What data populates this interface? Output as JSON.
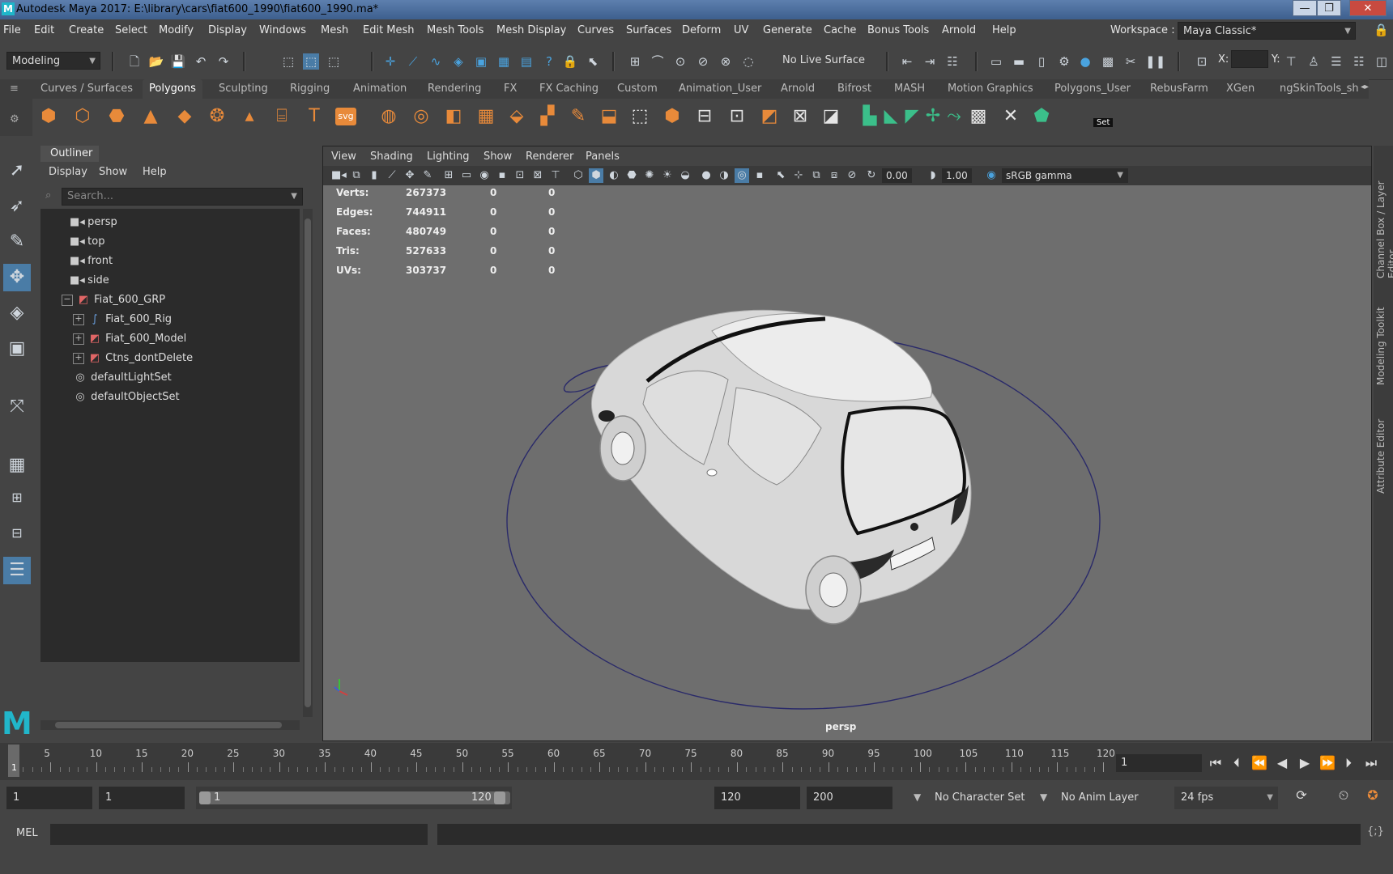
{
  "window": {
    "title": "Autodesk Maya 2017: E:\\library\\cars\\fiat600_1990\\fiat600_1990.ma*",
    "logo": "M"
  },
  "menubar": {
    "items": [
      "File",
      "Edit",
      "Create",
      "Select",
      "Modify",
      "Display",
      "Windows",
      "Mesh",
      "Edit Mesh",
      "Mesh Tools",
      "Mesh Display",
      "Curves",
      "Surfaces",
      "Deform",
      "UV",
      "Generate",
      "Cache",
      "Bonus Tools",
      "Arnold",
      "Help"
    ],
    "workspace_label": "Workspace :",
    "workspace_value": "Maya Classic*"
  },
  "toolbar": {
    "mode": "Modeling",
    "live_surface": "No Live Surface",
    "x_label": "X:",
    "y_label": "Y:"
  },
  "shelf": {
    "tabs": [
      "Curves / Surfaces",
      "Polygons",
      "Sculpting",
      "Rigging",
      "Animation",
      "Rendering",
      "FX",
      "FX Caching",
      "Custom",
      "Animation_User",
      "Arnold",
      "Bifrost",
      "MASH",
      "Motion Graphics",
      "Polygons_User",
      "RebusFarm",
      "XGen",
      "ngSkinTools_she"
    ],
    "active_tab": "Polygons",
    "svg_label": "svg",
    "text_label": "T",
    "set_label": "Set"
  },
  "outliner": {
    "title": "Outliner",
    "menu": [
      "Display",
      "Show",
      "Help"
    ],
    "search_placeholder": "Search...",
    "nodes": [
      {
        "label": "persp",
        "icon": "camera-icon",
        "expand": ""
      },
      {
        "label": "top",
        "icon": "camera-icon",
        "expand": ""
      },
      {
        "label": "front",
        "icon": "camera-icon",
        "expand": ""
      },
      {
        "label": "side",
        "icon": "camera-icon",
        "expand": ""
      },
      {
        "label": "Fiat_600_GRP",
        "icon": "group-icon",
        "expand": "−"
      },
      {
        "label": "Fiat_600_Rig",
        "icon": "curve-icon",
        "expand": "+"
      },
      {
        "label": "Fiat_600_Model",
        "icon": "group-icon",
        "expand": "+"
      },
      {
        "label": "Ctns_dontDelete",
        "icon": "group-icon",
        "expand": "+"
      },
      {
        "label": "defaultLightSet",
        "icon": "set-icon",
        "expand": ""
      },
      {
        "label": "defaultObjectSet",
        "icon": "set-icon",
        "expand": ""
      }
    ]
  },
  "panel": {
    "menu": [
      "View",
      "Shading",
      "Lighting",
      "Show",
      "Renderer",
      "Panels"
    ],
    "exposure": "0.00",
    "gamma": "1.00",
    "color_space": "sRGB gamma",
    "camera": "persp"
  },
  "hud": [
    {
      "label": "Verts:",
      "total": "267373",
      "sel": "0",
      "comp": "0"
    },
    {
      "label": "Edges:",
      "total": "744911",
      "sel": "0",
      "comp": "0"
    },
    {
      "label": "Faces:",
      "total": "480749",
      "sel": "0",
      "comp": "0"
    },
    {
      "label": "Tris:",
      "total": "527633",
      "sel": "0",
      "comp": "0"
    },
    {
      "label": "UVs:",
      "total": "303737",
      "sel": "0",
      "comp": "0"
    }
  ],
  "right_tabs": [
    "Channel Box / Layer Editor",
    "Modeling Toolkit",
    "Attribute Editor"
  ],
  "timeline": {
    "ticks": [
      "5",
      "10",
      "15",
      "20",
      "25",
      "30",
      "35",
      "40",
      "45",
      "50",
      "55",
      "60",
      "65",
      "70",
      "75",
      "80",
      "85",
      "90",
      "95",
      "100",
      "105",
      "110",
      "115",
      "120"
    ],
    "current_marker": "1",
    "current_frame": "1"
  },
  "range": {
    "start": "1",
    "playback_start": "1",
    "slider_start": "1",
    "slider_end": "120",
    "playback_end": "120",
    "end": "200",
    "character_set": "No Character Set",
    "anim_layer": "No Anim Layer",
    "fps": "24 fps"
  },
  "command": {
    "label": "MEL"
  },
  "colors": {
    "accent": "#4a7ca6",
    "shelf_orange": "#e88a3a",
    "maya_teal": "#21b6ca",
    "viewport_bg": "#6e6e6e"
  }
}
